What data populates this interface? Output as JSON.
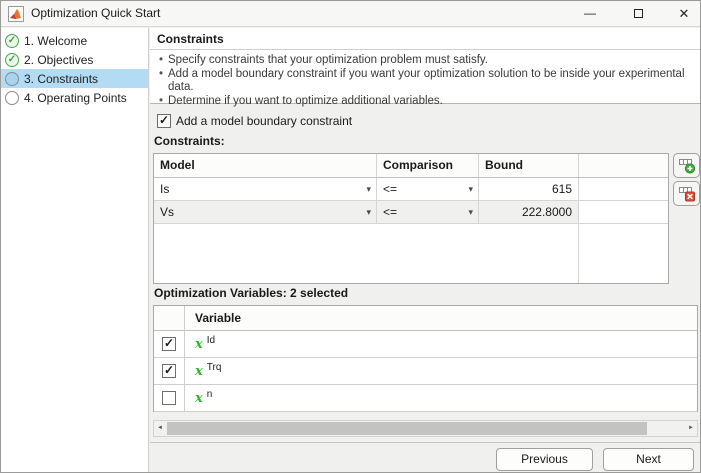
{
  "window": {
    "title": "Optimization Quick Start"
  },
  "icons": {
    "minimize": "—",
    "close": "✕",
    "check": "✓",
    "dropdown": "▾",
    "scroll_left": "◄",
    "scroll_right": "►"
  },
  "sidebar": {
    "items": [
      {
        "label": "1. Welcome",
        "status": "complete"
      },
      {
        "label": "2. Objectives",
        "status": "complete"
      },
      {
        "label": "3. Constraints",
        "status": "current"
      },
      {
        "label": "4. Operating Points",
        "status": "pending"
      }
    ]
  },
  "content": {
    "heading": "Constraints",
    "bullets": [
      "Specify constraints that your optimization problem must satisfy.",
      "Add a model boundary constraint if you want your optimization solution to be inside your experimental data.",
      "Determine if you want to optimize additional variables."
    ],
    "boundary_checkbox": {
      "label": "Add a model boundary constraint",
      "checked": true
    },
    "constraints_label": "Constraints:",
    "constraints_table": {
      "columns": [
        "Model",
        "Comparison",
        "Bound"
      ],
      "rows": [
        {
          "model": "Is",
          "comparison": "<=",
          "bound": "615"
        },
        {
          "model": "Vs",
          "comparison": "<=",
          "bound": "222.8000"
        }
      ]
    },
    "variables_label": "Optimization Variables: 2 selected",
    "variables_table": {
      "column_header": "Variable",
      "rows": [
        {
          "symbol": "x",
          "name": "Id",
          "checked": true
        },
        {
          "symbol": "x",
          "name": "Trq",
          "checked": true
        },
        {
          "symbol": "x",
          "name": "n",
          "checked": false
        }
      ]
    }
  },
  "footer": {
    "previous": "Previous",
    "next": "Next"
  },
  "colors": {
    "selection": "#b3dcf4",
    "step_complete_green": "#3fa33f",
    "variable_symbol_green": "#2db52d",
    "add_badge_green": "#3fae3f",
    "delete_badge_red": "#e0493c"
  }
}
